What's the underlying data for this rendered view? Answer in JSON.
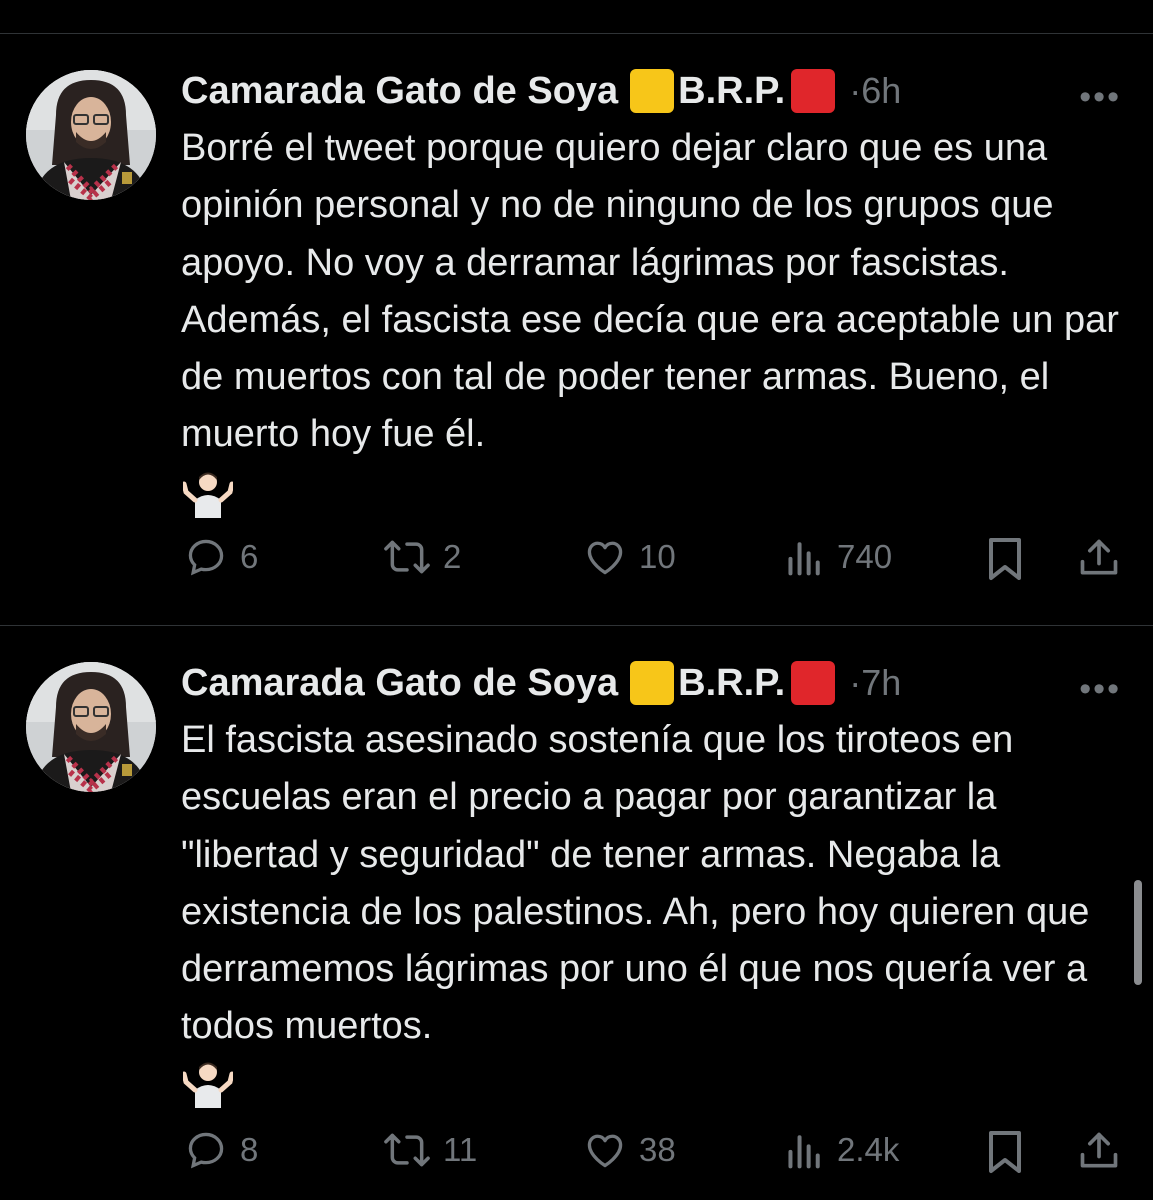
{
  "tweets": [
    {
      "author": "Camarada Gato de Soya",
      "org": "B.R.P.",
      "separator": "·",
      "time": "6h",
      "text": "Borré el tweet porque quiero dejar claro que es una opinión personal y no de ninguno de los grupos que apoyo. No voy a derramar lágrimas por fascistas. Además, el fascista ese decía que era aceptable un par de muertos con tal de poder tener armas. Bueno, el muerto hoy fue él.",
      "emoji": "🤷🏻‍♂️",
      "replies": "6",
      "reposts": "2",
      "likes": "10",
      "views": "740"
    },
    {
      "author": "Camarada Gato de Soya",
      "org": "B.R.P.",
      "separator": "·",
      "time": "7h",
      "text": "El fascista asesinado sostenía que los tiroteos en escuelas eran el precio a pagar por garantizar la \"libertad y seguridad\" de tener armas. Negaba la existencia de los palestinos. Ah, pero hoy quieren que derramemos lágrimas por uno él que nos quería ver a todos muertos.",
      "emoji": "🤷🏻‍♂️",
      "replies": "8",
      "reposts": "11",
      "likes": "38",
      "views": "2.4k"
    }
  ],
  "colors": {
    "background": "#000000",
    "text": "#e7e9ea",
    "muted": "#71767b",
    "divider": "#2f3336",
    "flag_yellow": "#f7c619",
    "flag_red": "#e0262b"
  },
  "icons": [
    "more-icon",
    "reply-icon",
    "repost-icon",
    "like-icon",
    "views-icon",
    "bookmark-icon",
    "share-icon",
    "shrug-emoji"
  ]
}
